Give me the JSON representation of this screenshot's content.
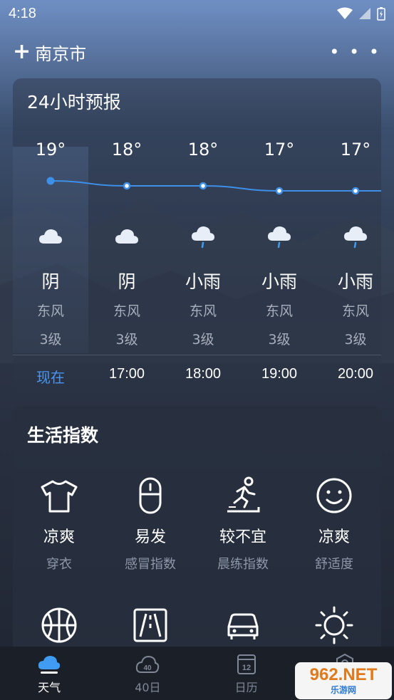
{
  "status_bar": {
    "time": "4:18"
  },
  "header": {
    "city": "南京市",
    "add_icon": "plus-icon",
    "more_icon": "more-dots-icon"
  },
  "forecast": {
    "title": "24小时预报",
    "hours": [
      {
        "temp": "19°",
        "condition": "阴",
        "wind": "东风",
        "level": "3级",
        "time": "现在",
        "icon": "cloudy-icon",
        "temp_value": 19
      },
      {
        "temp": "18°",
        "condition": "阴",
        "wind": "东风",
        "level": "3级",
        "time": "17:00",
        "icon": "cloudy-icon",
        "temp_value": 18
      },
      {
        "temp": "18°",
        "condition": "小雨",
        "wind": "东风",
        "level": "3级",
        "time": "18:00",
        "icon": "light-rain-icon",
        "temp_value": 18
      },
      {
        "temp": "17°",
        "condition": "小雨",
        "wind": "东风",
        "level": "3级",
        "time": "19:00",
        "icon": "light-rain-icon",
        "temp_value": 17
      },
      {
        "temp": "17°",
        "condition": "小雨",
        "wind": "东风",
        "level": "3级",
        "time": "20:00",
        "icon": "light-rain-icon",
        "temp_value": 17
      }
    ]
  },
  "life_index": {
    "title": "生活指数",
    "items": [
      {
        "value": "凉爽",
        "label": "穿衣",
        "icon": "shirt-icon"
      },
      {
        "value": "易发",
        "label": "感冒指数",
        "icon": "pill-icon"
      },
      {
        "value": "较不宜",
        "label": "晨练指数",
        "icon": "running-icon"
      },
      {
        "value": "凉爽",
        "label": "舒适度",
        "icon": "smiley-icon"
      },
      {
        "value": "",
        "label": "",
        "icon": "basketball-icon"
      },
      {
        "value": "",
        "label": "",
        "icon": "road-icon"
      },
      {
        "value": "",
        "label": "",
        "icon": "car-icon"
      },
      {
        "value": "",
        "label": "",
        "icon": "sun-icon"
      }
    ]
  },
  "tabbar": {
    "tabs": [
      {
        "label": "天气",
        "icon": "weather-cloud-icon",
        "active": true
      },
      {
        "label": "40日",
        "icon": "40-day-icon",
        "active": false
      },
      {
        "label": "日历",
        "icon": "calendar-icon",
        "active": false,
        "calendar_day": "12"
      },
      {
        "label": "",
        "icon": "location-icon",
        "active": false
      }
    ]
  },
  "watermark": {
    "top": "962.NET",
    "bottom": "乐游网"
  },
  "colors": {
    "accent": "#4a96f0",
    "temp_line": "#3e8fe8"
  }
}
